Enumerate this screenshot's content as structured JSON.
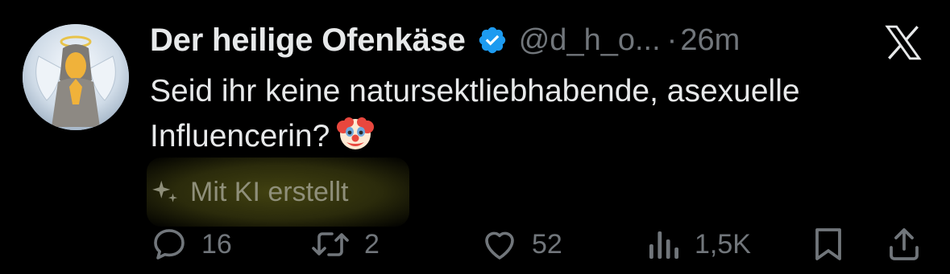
{
  "tweet": {
    "author_name": "Der heilige Ofenkäse",
    "handle": "@d_h_o...",
    "separator": "·",
    "time": "26m",
    "text_line1": "Seid ihr keine natursektliebhabende, asexuelle",
    "text_line2": "Influencerin?",
    "emoji": "clown-face-icon",
    "ai_label": "Mit KI erstellt"
  },
  "actions": {
    "replies": "16",
    "retweets": "2",
    "likes": "52",
    "views": "1,5K"
  },
  "colors": {
    "background": "#000000",
    "text": "#e7e9ea",
    "muted": "#71767b",
    "verified": "#1d9bf0",
    "ai_highlight": "#6b6b1e"
  },
  "icons": [
    "verified-badge-icon",
    "x-logo-icon",
    "sparkle-icon",
    "reply-icon",
    "retweet-icon",
    "like-icon",
    "views-icon",
    "bookmark-icon",
    "share-icon"
  ]
}
